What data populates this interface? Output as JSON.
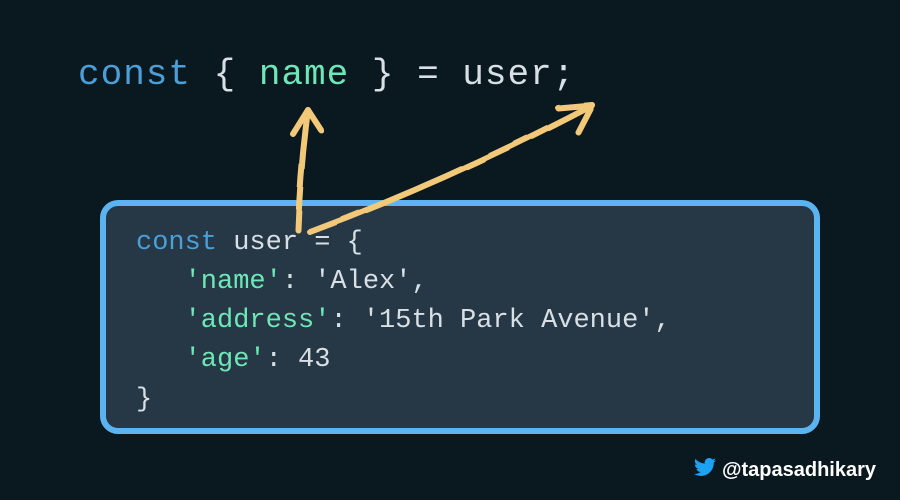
{
  "top_line": {
    "const_kw": "const",
    "lbrace": " { ",
    "prop": "name",
    "rbrace": " } ",
    "eq": "= ",
    "source": "user",
    "semi": ";"
  },
  "box": {
    "line1_kw": "const",
    "line1_rest": " user = {",
    "line2_key": "'name'",
    "line2_colon": ": ",
    "line2_val": "'Alex'",
    "line2_comma": ",",
    "line3_key": "'address'",
    "line3_colon": ": ",
    "line3_val": "'15th Park Avenue'",
    "line3_comma": ",",
    "line4_key": "'age'",
    "line4_colon": ": ",
    "line4_val": "43",
    "line5": "}"
  },
  "attribution": {
    "handle": "@tapasadhikary"
  },
  "colors": {
    "bg": "#0a1820",
    "box_bg": "#263845",
    "box_border": "#5bb3f0",
    "keyword": "#4a9fd8",
    "identifier": "#6ee7b7",
    "plain": "#d8dfe5",
    "arrow": "#f2c879"
  }
}
